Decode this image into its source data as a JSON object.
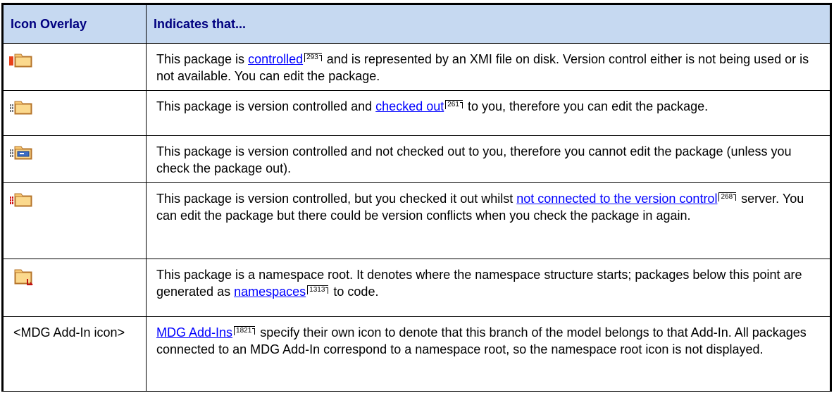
{
  "table": {
    "headers": [
      "Icon Overlay",
      "Indicates that..."
    ],
    "rows": [
      {
        "icon": "folder-controlled-icon",
        "text_before": "This package is ",
        "link_text": "controlled",
        "page_ref": "293",
        "text_after": " and is represented by an XMI file on disk. Version control either is not being used or is not available. You can edit the package."
      },
      {
        "icon": "folder-checked-out-icon",
        "text_before": "This package is version controlled and ",
        "link_text": "checked out",
        "page_ref": "261",
        "text_after": " to you, therefore you can edit the package."
      },
      {
        "icon": "folder-locked-icon",
        "text": "This package is version controlled and not checked out to you, therefore you cannot edit the package (unless you check the package out)."
      },
      {
        "icon": "folder-offline-checked-out-icon",
        "text_before": "This package is version controlled, but you checked it out whilst ",
        "link_text": "not connected to the version control",
        "page_ref": "268",
        "text_after": " server. You can edit the package but there could be version conflicts when you check the package in again."
      },
      {
        "icon": "folder-namespace-root-icon",
        "text_before": "This package is a namespace root. It denotes where the namespace structure starts; packages below this point are generated as ",
        "link_text": "namespaces",
        "page_ref": "1313",
        "text_after": " to code."
      },
      {
        "icon_label": "<MDG Add-In icon>",
        "link_text": "MDG Add-Ins",
        "page_ref": "1821",
        "text_after": " specify their own icon to denote that this branch of the model belongs to that Add-In. All packages connected to an MDG Add-In correspond to a namespace root, so the namespace root icon is not displayed."
      }
    ]
  }
}
